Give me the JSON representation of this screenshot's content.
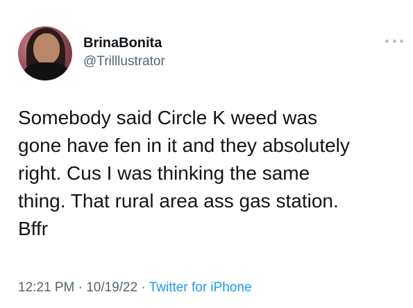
{
  "tweet": {
    "author": {
      "display_name": "BrinaBonita",
      "handle": "@Trilllustrator"
    },
    "text": "Somebody said Circle K weed was\ngone have fen in it and they absolutely\nright. Cus I was thinking the same\nthing. That rural area ass gas station.\nBffr",
    "time": "12:21 PM",
    "separator1": "·",
    "date": "10/19/22",
    "separator2": "·",
    "source": "Twitter for iPhone"
  },
  "icons": {
    "more": "more-horizontal-icon",
    "avatar": "profile-photo"
  },
  "colors": {
    "text": "#0f1419",
    "secondary": "#536471",
    "link": "#1d9bf0",
    "more_dots": "#b9c3ca"
  }
}
